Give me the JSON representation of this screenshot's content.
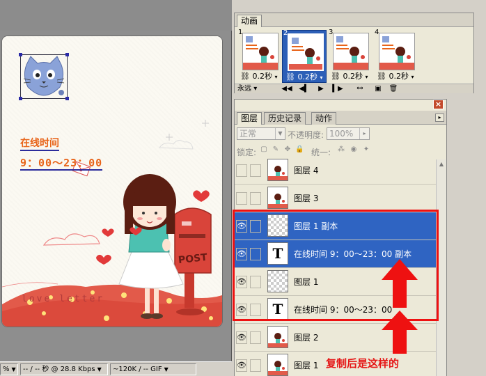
{
  "canvas": {
    "online_title": "在线时间",
    "online_hours": "9：00～23：00",
    "love_text": "love letter",
    "post_text": "POST"
  },
  "status_bar": {
    "zoom": "%",
    "download_time": "-- / -- 秒 @ 28.8 Kbps",
    "file_size": "~120K / -- GIF"
  },
  "animation": {
    "tab_label": "动画",
    "frames": [
      {
        "num": "1",
        "time": "0.2秒"
      },
      {
        "num": "2",
        "time": "0.2秒",
        "selected": true
      },
      {
        "num": "3",
        "time": "0.2秒"
      },
      {
        "num": "4",
        "time": "0.2秒"
      }
    ],
    "loop_select": "永远"
  },
  "layers_panel": {
    "tabs": [
      "图层",
      "历史记录",
      "动作"
    ],
    "blend_mode": "正常",
    "opacity_label": "不透明度:",
    "opacity_value": "100%",
    "lock_label": "锁定:",
    "unify_label": "统一:",
    "rows": [
      {
        "name": "图层 4",
        "thumb": "image",
        "eye": false,
        "selected": false
      },
      {
        "name": "图层 3",
        "thumb": "image",
        "eye": false,
        "selected": false
      },
      {
        "name": "图层 1 副本",
        "thumb": "checker",
        "eye": true,
        "selected": true
      },
      {
        "name": "在线时间  9：00～23：00 副本",
        "thumb": "T",
        "eye": true,
        "selected": true
      },
      {
        "name": "图层 1",
        "thumb": "checker",
        "eye": true,
        "selected": false
      },
      {
        "name": "在线时间  9：00～23：00",
        "thumb": "T",
        "eye": true,
        "selected": false
      },
      {
        "name": "图层 2",
        "thumb": "image",
        "eye": true,
        "selected": false
      },
      {
        "name": "图层 1",
        "thumb": "image",
        "eye": true,
        "selected": false
      }
    ]
  },
  "annotation": {
    "text": "复制后是这样的",
    "color": "#e51616"
  },
  "colors": {
    "selection_blue": "#2f64c2",
    "panel_bg": "#ece9d8",
    "accent_orange": "#e8641a"
  }
}
